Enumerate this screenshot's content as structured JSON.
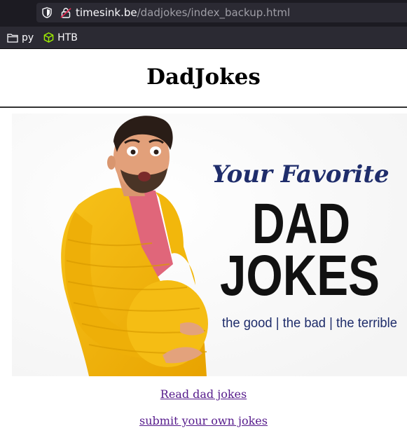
{
  "browser": {
    "url_host": "timesink.be",
    "url_path": "/dadjokes/index_backup.html",
    "bookmarks": [
      {
        "label": "py",
        "icon": "folder-icon"
      },
      {
        "label": "HTB",
        "icon": "cube-icon"
      }
    ]
  },
  "page": {
    "title": "DadJokes",
    "banner": {
      "line1": "Your Favorite",
      "line2": "DAD",
      "line3": "JOKES",
      "tagline": "the good | the bad | the terrible"
    },
    "links": {
      "read": "Read dad jokes",
      "submit": "submit your own jokes"
    }
  },
  "colors": {
    "banner_text_blue": "#1f2d6b",
    "banner_text_black": "#111111",
    "cardigan": "#f4b400",
    "link_visited": "#551a8b"
  }
}
